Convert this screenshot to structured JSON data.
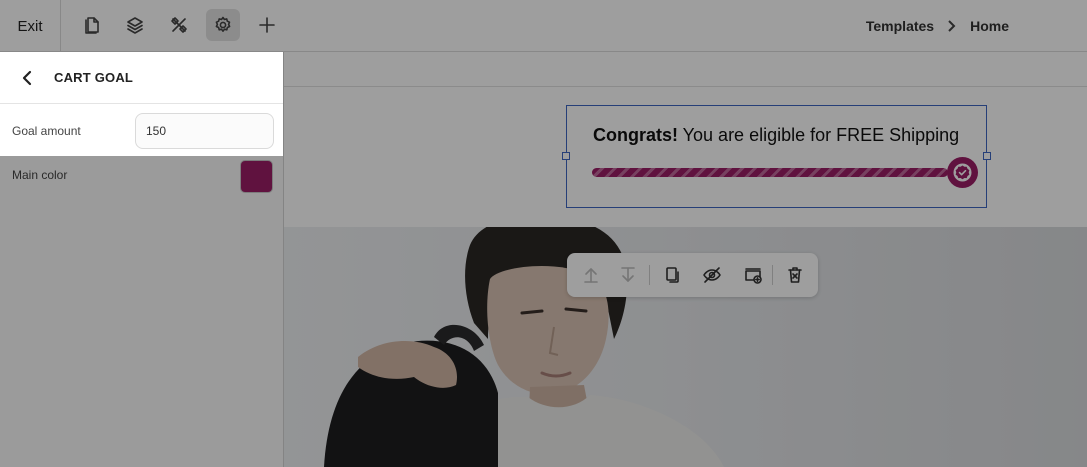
{
  "topbar": {
    "exit_label": "Exit",
    "tools": [
      {
        "icon": "page-icon"
      },
      {
        "icon": "layers-icon"
      },
      {
        "icon": "tools-icon"
      },
      {
        "icon": "gear-icon",
        "active": true
      },
      {
        "icon": "plus-icon"
      }
    ],
    "breadcrumb": [
      "Templates",
      "Home"
    ]
  },
  "sidebar": {
    "title": "CART GOAL",
    "goal_amount": {
      "label": "Goal amount",
      "value": "150"
    },
    "main_color": {
      "label": "Main color",
      "value": "#9b1d66"
    }
  },
  "cart_goal": {
    "bold_text": "Congrats!",
    "message": " You are eligible for FREE Shipping",
    "progress": 1.0,
    "bar_color": "#9b1d66"
  },
  "floating_toolbar": {
    "buttons": [
      {
        "icon": "move-up-icon",
        "disabled": true
      },
      {
        "icon": "move-down-icon",
        "disabled": true
      },
      {
        "icon": "duplicate-icon"
      },
      {
        "icon": "hide-icon"
      },
      {
        "icon": "add-section-icon"
      },
      {
        "icon": "delete-icon"
      }
    ]
  }
}
